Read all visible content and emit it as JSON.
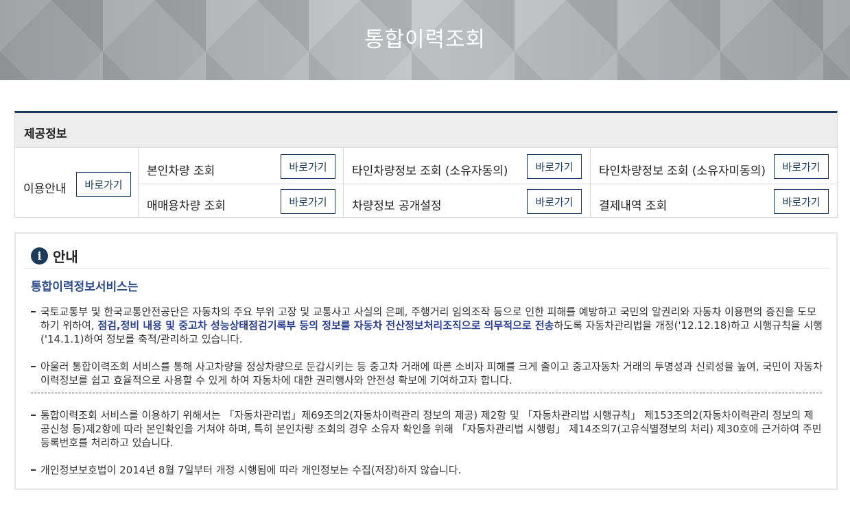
{
  "banner": {
    "title": "통합이력조회"
  },
  "provide": {
    "heading": "제공정보",
    "usage": {
      "label": "이용안내",
      "button": "바로가기"
    },
    "items": [
      {
        "label": "본인차량 조회",
        "button": "바로가기"
      },
      {
        "label": "타인차량정보 조회 (소유자동의)",
        "button": "바로가기"
      },
      {
        "label": "타인차량정보 조회 (소유자미동의)",
        "button": "바로가기"
      },
      {
        "label": "매매용차량 조회",
        "button": "바로가기"
      },
      {
        "label": "차량정보 공개설정",
        "button": "바로가기"
      },
      {
        "label": "결제내역 조회",
        "button": "바로가기"
      }
    ]
  },
  "notice": {
    "heading": "안내",
    "icon": "info-icon",
    "subtitle": "통합이력정보서비스는",
    "p1_pre": "국토교통부 및 한국교통안전공단은 자동차의 주요 부위 고장 및 교통사고 사실의 은폐, 주행거리 임의조작 등으로 인한 피해를 예방하고 국민의 알권리와 자동차 이용편의 증진을 도모하기 위하여, ",
    "p1_bold": "점검,정비 내용 및 중고차 성능상태점검기록부 등의 정보를 자동차 전산정보처리조직으로 의무적으로 전송",
    "p1_post": "하도록 자동차관리법을 개정('12.12.18)하고 시행규칙을 시행('14.1.1)하여 정보를 축적/관리하고 있습니다.",
    "p2": "아울러 통합이력조회 서비스를 통해 사고차량을 정상차량으로 둔갑시키는 등 중고차 거래에 따른 소비자 피해를 크게 줄이고 중고자동차 거래의 투명성과 신뢰성을 높여, 국민이 자동차 이력정보를 쉽고 효율적으로 사용할 수 있게 하여 자동차에 대한 권리행사와 안전성 확보에 기여하고자 합니다.",
    "p3": "통합이력조회 서비스를 이용하기 위해서는 「자동차관리법」제69조의2(자동차이력관리 정보의 제공) 제2항 및 「자동차관리법 시행규칙」 제153조의2(자동차이력관리 정보의 제공신청 등)제2항에 따라 본인확인을 거쳐야 하며, 특히 본인차량 조회의 경우 소유자 확인을 위해 「자동차관리법 시행령」 제14조의7(고유식별정보의 처리) 제30호에 근거하여 주민등록번호를 처리하고 있습니다.",
    "p4": "개인정보보호법이 2014년 8월 7일부터 개정 시행됨에 따라 개인정보는 수집(저장)하지 않습니다."
  }
}
